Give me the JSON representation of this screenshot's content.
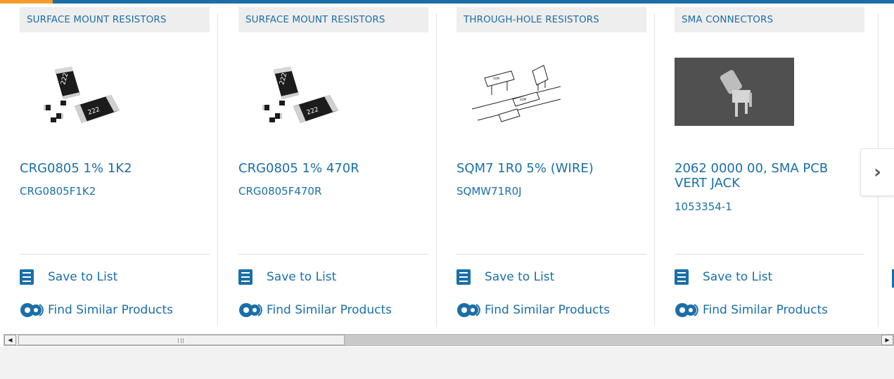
{
  "carousel": {
    "products": [
      {
        "category": "SURFACE MOUNT RESISTORS",
        "name": "CRG0805 1% 1K2",
        "part_number": "CRG0805F1K2",
        "image": "smd-resistor-image",
        "save_label": "Save to List",
        "find_label": "Find Similar Products"
      },
      {
        "category": "SURFACE MOUNT RESISTORS",
        "name": "CRG0805 1% 470R",
        "part_number": "CRG0805F470R",
        "image": "smd-resistor-image",
        "save_label": "Save to List",
        "find_label": "Find Similar Products"
      },
      {
        "category": "THROUGH-HOLE RESISTORS",
        "name": "SQM7 1R0 5% (WIRE)",
        "part_number": "SQMW71R0J",
        "image": "wirewound-resistor-drawing",
        "save_label": "Save to List",
        "find_label": "Find Similar Products"
      },
      {
        "category": "SMA CONNECTORS",
        "name": "2062 0000 00, SMA PCB VERT JACK",
        "part_number": "1053354-1",
        "image": "sma-connector-photo",
        "save_label": "Save to List",
        "find_label": "Find Similar Products"
      }
    ],
    "next_icon": "chevron-right-icon"
  },
  "colors": {
    "link": "#1a6fa9",
    "top_bar": "#1a6fa9",
    "top_accent": "#f39c2b",
    "category_bg": "#eeeeee"
  },
  "scrollbar": {
    "left_icon": "arrow-left-icon",
    "right_icon": "arrow-right-icon"
  }
}
